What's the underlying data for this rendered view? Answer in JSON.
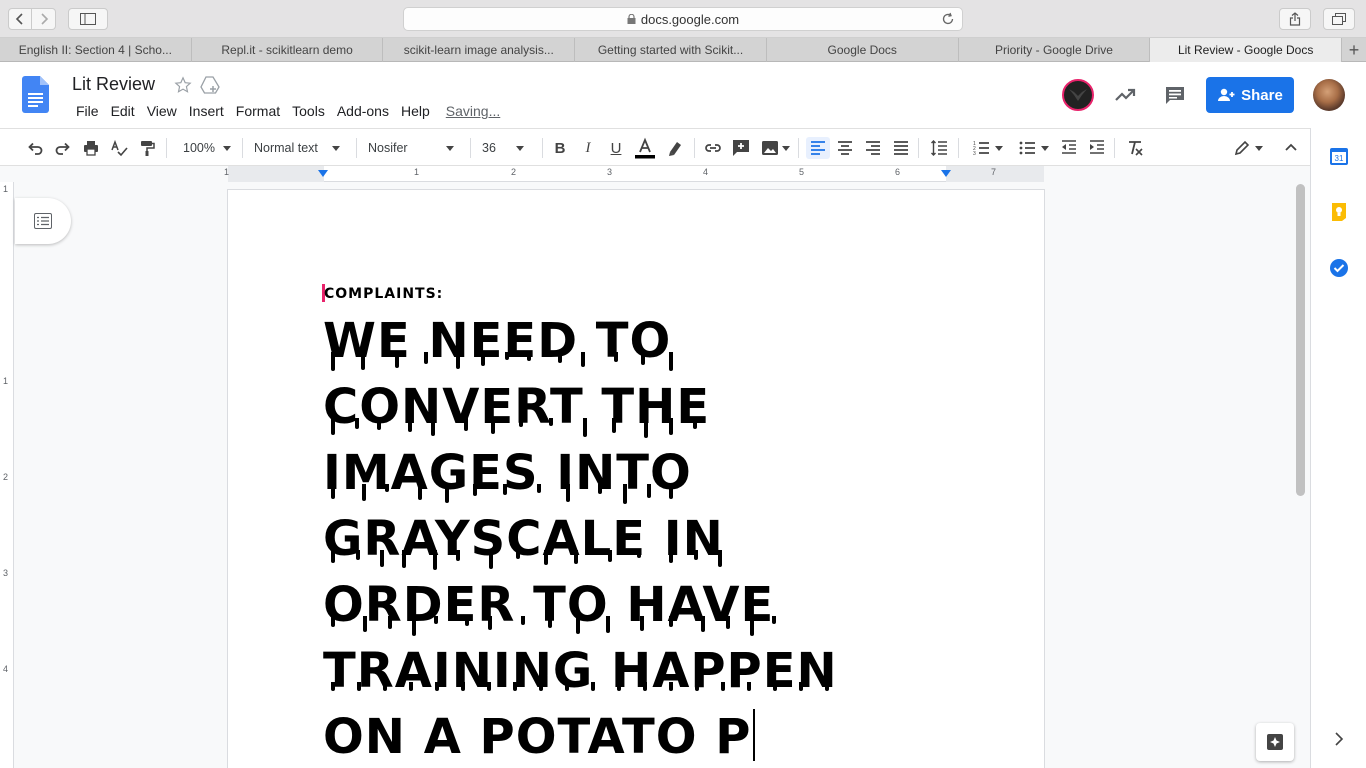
{
  "browser": {
    "url": "docs.google.com",
    "tabs": [
      {
        "label": "English II: Section 4 | Scho..."
      },
      {
        "label": "Repl.it - scikitlearn demo"
      },
      {
        "label": "scikit-learn image analysis..."
      },
      {
        "label": "Getting started with Scikit..."
      },
      {
        "label": "Google Docs"
      },
      {
        "label": "Priority - Google Drive"
      },
      {
        "label": "Lit Review - Google Docs"
      }
    ],
    "new_tab": "+"
  },
  "doc": {
    "title": "Lit Review",
    "status": "Saving...",
    "menu": [
      {
        "label": "File"
      },
      {
        "label": "Edit"
      },
      {
        "label": "View"
      },
      {
        "label": "Insert"
      },
      {
        "label": "Format"
      },
      {
        "label": "Tools"
      },
      {
        "label": "Add-ons"
      },
      {
        "label": "Help"
      }
    ],
    "share_label": "Share"
  },
  "toolbar": {
    "zoom": "100%",
    "style": "Normal text",
    "font": "Nosifer",
    "size": "36"
  },
  "ruler": {
    "marks": [
      "1",
      "1",
      "2",
      "3",
      "4",
      "5",
      "6",
      "7"
    ],
    "vmarks": [
      "1",
      "1",
      "2",
      "3",
      "4"
    ]
  },
  "content": {
    "heading": "COMPLAINTS:",
    "lines": [
      "WE NEED TO",
      "CONVERT THE",
      "IMAGES INTO",
      "GRAYSCALE IN",
      "ORDER TO HAVE",
      "TRAINING HAPPEN",
      "ON A POTATO P"
    ]
  },
  "side_panel": {
    "calendar_day": "31"
  },
  "colors": {
    "accent": "#1a73e8",
    "caret": "#e8236b",
    "keep": "#fbbc04"
  }
}
